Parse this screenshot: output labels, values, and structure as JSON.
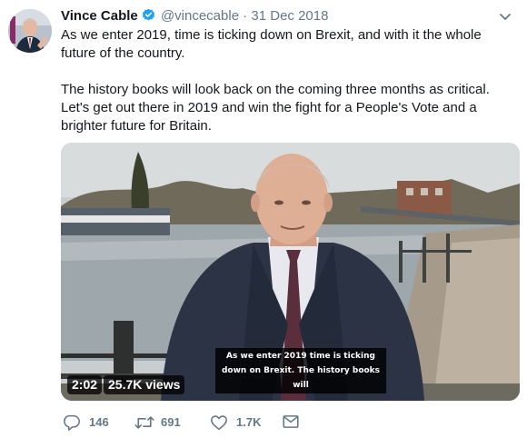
{
  "tweet": {
    "author": {
      "name": "Vince Cable",
      "handle": "@vincecable",
      "verified": true
    },
    "separator": "·",
    "date": "31 Dec 2018",
    "paragraphs": [
      "As we enter 2019, time is ticking down on Brexit, and with it the whole future of the country.",
      "The history books will look back on the coming three months as critical.",
      "Let's get out there in 2019 and win the fight for a People's Vote and a brighter future for Britain."
    ],
    "video": {
      "subtitle_line1": "As we enter 2019 time is ticking",
      "subtitle_line2": "down on Brexit. The history books will",
      "duration": "2:02",
      "views": "25.7K views"
    },
    "actions": {
      "reply_count": "146",
      "retweet_count": "691",
      "like_count": "1.7K"
    }
  },
  "icons": {
    "verified": "verified-badge-icon",
    "more": "chevron-down-icon",
    "reply": "reply-icon",
    "retweet": "retweet-icon",
    "like": "heart-icon",
    "dm": "envelope-icon"
  },
  "colors": {
    "text": "#14171a",
    "secondary": "#657786",
    "verified": "#1da1f2"
  }
}
